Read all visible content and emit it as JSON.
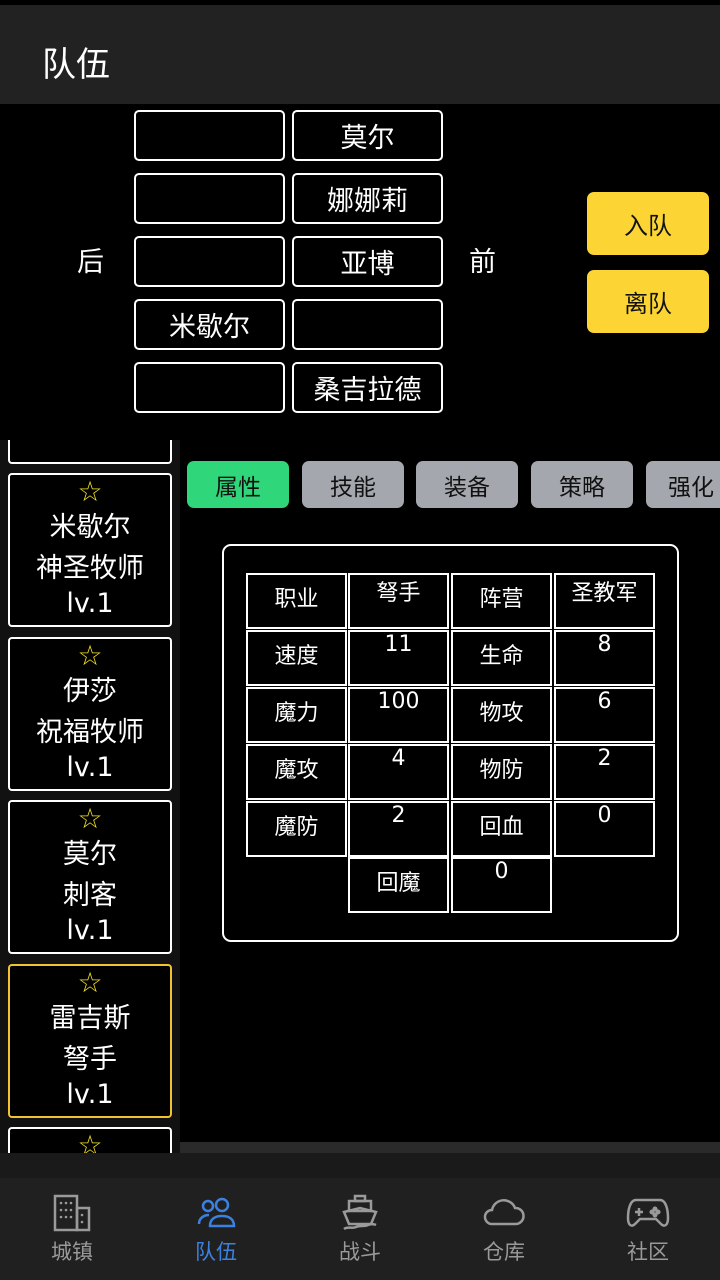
{
  "header": {
    "title": "队伍"
  },
  "formation": {
    "back_label": "后",
    "front_label": "前",
    "back_slots": [
      "",
      "",
      "",
      "米歇尔",
      ""
    ],
    "front_slots": [
      "莫尔",
      "娜娜莉",
      "亚博",
      "",
      "桑吉拉德"
    ],
    "join_label": "入队",
    "leave_label": "离队",
    "button_color": "#fcd535"
  },
  "heroes": [
    {
      "name": "",
      "class": "",
      "level": "...."
    },
    {
      "name": "米歇尔",
      "class": "神圣牧师",
      "level": "lv.1"
    },
    {
      "name": "伊莎",
      "class": "祝福牧师",
      "level": "lv.1"
    },
    {
      "name": "莫尔",
      "class": "刺客",
      "level": "lv.1"
    },
    {
      "name": "雷吉斯",
      "class": "弩手",
      "level": "lv.1",
      "selected": true
    },
    {
      "name": "",
      "class": "",
      "level": ""
    }
  ],
  "tabs": [
    {
      "label": "属性",
      "active": true
    },
    {
      "label": "技能"
    },
    {
      "label": "装备"
    },
    {
      "label": "策略"
    },
    {
      "label": "强化"
    }
  ],
  "stats": {
    "rows": [
      [
        "职业",
        "弩手",
        "阵营",
        "圣教军"
      ],
      [
        "速度",
        "11",
        "生命",
        "8"
      ],
      [
        "魔力",
        "100",
        "物攻",
        "6"
      ],
      [
        "魔攻",
        "4",
        "物防",
        "2"
      ],
      [
        "魔防",
        "2",
        "回血",
        "0"
      ]
    ],
    "last": [
      "回魔",
      "0"
    ]
  },
  "nav": [
    {
      "label": "城镇",
      "icon": "city-icon"
    },
    {
      "label": "队伍",
      "icon": "team-icon",
      "active": true
    },
    {
      "label": "战斗",
      "icon": "ship-icon"
    },
    {
      "label": "仓库",
      "icon": "cloud-icon"
    },
    {
      "label": "社区",
      "icon": "gamepad-icon"
    }
  ],
  "colors": {
    "active_tab": "#2fd67a",
    "nav_active": "#3b82e0",
    "selected_card": "#f2c330",
    "star": "#f0e020"
  }
}
